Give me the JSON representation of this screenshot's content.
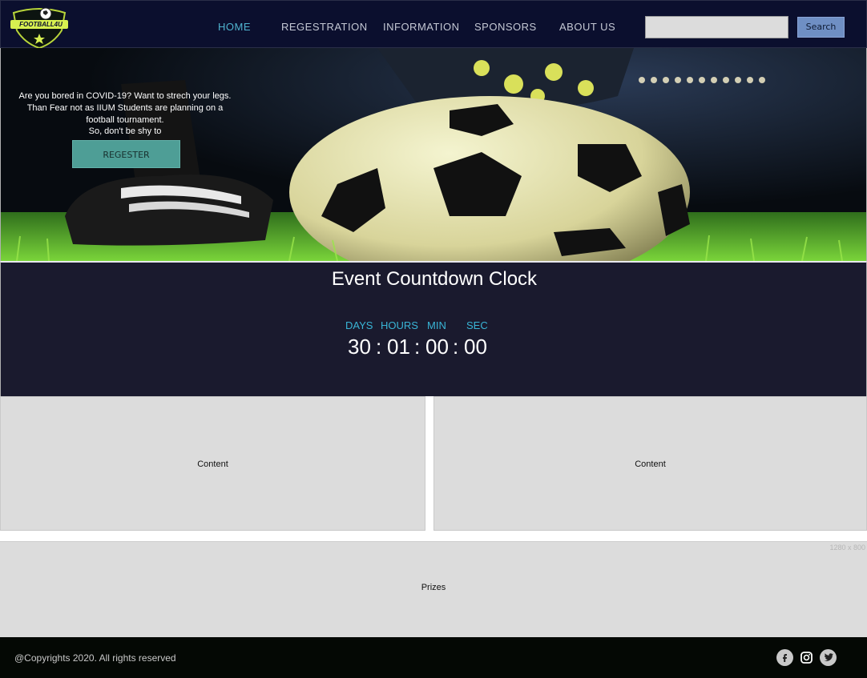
{
  "header": {
    "logo_text": "FOOTBALL4U",
    "nav": [
      {
        "label": "HOME",
        "active": true
      },
      {
        "label": "REGESTRATION",
        "active": false
      },
      {
        "label": "INFORMATION",
        "active": false
      },
      {
        "label": "SPONSORS",
        "active": false
      },
      {
        "label": "ABOUT US",
        "active": false
      }
    ],
    "search": {
      "value": "",
      "placeholder": "",
      "button_label": "Search"
    }
  },
  "hero": {
    "text": "Are you bored in COVID-19? Want to strech your legs. Than Fear not as IIUM Students are planning on a football tournament.",
    "subtext": "So, don't be shy to",
    "button_label": "REGESTER"
  },
  "countdown": {
    "title": "Event Countdown Clock",
    "labels": {
      "days": "DAYS",
      "hours": "HOURS",
      "min": "MIN",
      "sec": "SEC"
    },
    "values": {
      "days": "30",
      "hours": "01",
      "min": "00",
      "sec": "00"
    },
    "separator": ":"
  },
  "content": {
    "left": "Content",
    "right": "Content"
  },
  "prizes": {
    "label": "Prizes",
    "dimension_note": "1280 x 800"
  },
  "footer": {
    "copyright": "@Copyrights 2020. All rights reserved",
    "social": [
      "facebook-icon",
      "instagram-icon",
      "twitter-icon"
    ]
  },
  "colors": {
    "nav_bg": "#0b0f2e",
    "nav_active": "#4fb3cf",
    "countdown_bg": "#1a1a2e",
    "countdown_label": "#39b5d6",
    "register_button": "#4e9e96",
    "search_button": "#6f8fc4",
    "footer_bg": "#040804"
  }
}
